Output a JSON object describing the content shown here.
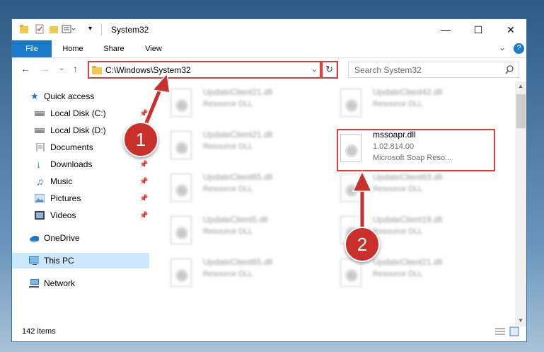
{
  "window": {
    "title": "System32"
  },
  "ribbon": {
    "tabs": [
      "File",
      "Home",
      "Share",
      "View"
    ]
  },
  "address": {
    "path": "C:\\Windows\\System32"
  },
  "search": {
    "placeholder": "Search System32"
  },
  "sidebar": {
    "items": [
      {
        "label": "Quick access",
        "icon": "star-icon",
        "pinned": false
      },
      {
        "label": "Local Disk (C:)",
        "icon": "drive-icon",
        "pinned": true
      },
      {
        "label": "Local Disk (D:)",
        "icon": "drive-icon",
        "pinned": false
      },
      {
        "label": "Documents",
        "icon": "documents-icon",
        "pinned": true
      },
      {
        "label": "Downloads",
        "icon": "download-icon",
        "pinned": true
      },
      {
        "label": "Music",
        "icon": "music-icon",
        "pinned": true
      },
      {
        "label": "Pictures",
        "icon": "pictures-icon",
        "pinned": true
      },
      {
        "label": "Videos",
        "icon": "videos-icon",
        "pinned": true
      },
      {
        "label": "OneDrive",
        "icon": "onedrive-icon",
        "pinned": false
      },
      {
        "label": "This PC",
        "icon": "computer-icon",
        "pinned": false,
        "selected": true
      },
      {
        "label": "Network",
        "icon": "network-icon",
        "pinned": false
      }
    ]
  },
  "files": {
    "left": [
      {
        "name": "UpdateClient21.dll",
        "type": "Resource DLL"
      },
      {
        "name": "UpdateClient21.dll",
        "type": "Resource DLL"
      },
      {
        "name": "UpdateClient65.dll",
        "type": "Resource DLL"
      },
      {
        "name": "UpdateClient5.dll",
        "type": "Resource DLL"
      },
      {
        "name": "UpdateClient65.dll",
        "type": "Resource DLL"
      }
    ],
    "right": [
      {
        "name": "UpdateClient42.dll",
        "type": "Resource DLL"
      },
      {
        "name": "mssoapr.dll",
        "version": "1.02.814.00",
        "type": "Microsoft Soap Reso..."
      },
      {
        "name": "UpdateClient63.dll",
        "type": "Resource DLL"
      },
      {
        "name": "UpdateClient19.dll",
        "type": "Resource DLL"
      },
      {
        "name": "UpdateClient21.dll",
        "type": "Resource DLL"
      }
    ]
  },
  "status": {
    "item_count": "142 items"
  },
  "annotations": {
    "step1": "1",
    "step2": "2"
  },
  "colors": {
    "accent": "#1979ca",
    "highlight": "#d9403c"
  }
}
